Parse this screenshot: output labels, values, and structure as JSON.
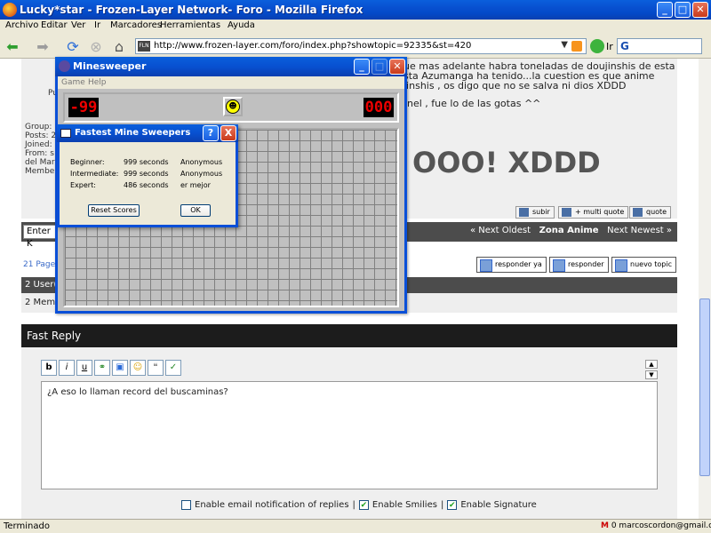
{
  "browser": {
    "title": "Lucky*star - Frozen-Layer Network- Foro - Mozilla Firefox",
    "menu": [
      "Archivo",
      "Editar",
      "Ver",
      "Ir",
      "Marcadores",
      "Herramientas",
      "Ayuda"
    ],
    "url": "http://www.frozen-layer.com/foro/index.php?showtopic=92335&st=420",
    "go_label": "Ir",
    "status": "Terminado",
    "gmail": "0 marcoscordon@gmail.com"
  },
  "post": {
    "lines": [
      "ue mas adelante habra toneladas de doujinshis de esta",
      "sta Azumanga ha tenido...la cuestion es que anime",
      "jinshis , os digo que no se salva ni dios XDDD",
      "nel , fue lo de las gotas ^^"
    ],
    "big_text": "OOO! XDDD",
    "left_info": [
      "Pu",
      "Group:",
      "Posts: 2",
      "Joined:",
      "From: s",
      "del Mar",
      "Member"
    ],
    "buttons": [
      "subir",
      "+ multi quote",
      "quote"
    ]
  },
  "jump": {
    "input_value": "Enter K",
    "prev": "« Next Oldest",
    "section": "Zona Anime",
    "next": "Next Newest »"
  },
  "pages_label": "21 Page",
  "reply_buttons": [
    "responder ya",
    "responder",
    "nuevo topic"
  ],
  "users_bar": "2 User(s",
  "members_row": "2 Memb",
  "fast_reply": {
    "title": "Fast Reply",
    "text": "¿A eso lo llaman record del buscaminas?",
    "tools": [
      "b",
      "i",
      "u"
    ],
    "options": [
      "Enable email notification of replies",
      "Enable Smilies",
      "Enable Signature"
    ],
    "options_checked": [
      false,
      true,
      true
    ],
    "sep": "|"
  },
  "minesweeper": {
    "title": "Minesweeper",
    "menu": [
      "Game",
      "Help"
    ],
    "mine_counter": "-99",
    "timer": "000"
  },
  "dialog": {
    "title": "Fastest Mine Sweepers",
    "scores": [
      {
        "level": "Beginner:",
        "time": "999 seconds",
        "name": "Anonymous"
      },
      {
        "level": "Intermediate:",
        "time": "999 seconds",
        "name": "Anonymous"
      },
      {
        "level": "Expert:",
        "time": "486 seconds",
        "name": "er mejor"
      }
    ],
    "reset_label": "Reset Scores",
    "ok_label": "OK",
    "help_label": "?",
    "close_label": "X"
  }
}
